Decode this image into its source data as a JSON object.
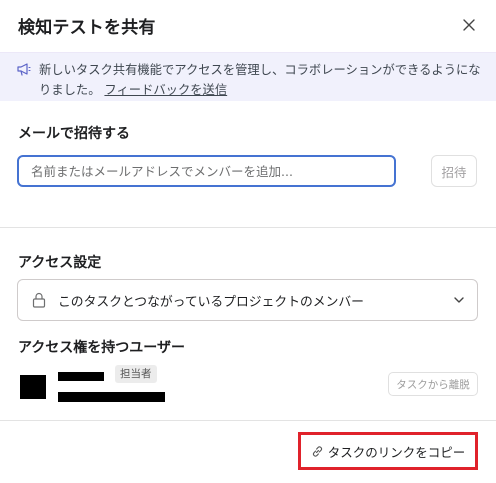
{
  "dialog": {
    "title": "検知テストを共有",
    "close_icon": "close-icon"
  },
  "banner": {
    "icon": "megaphone-icon",
    "text": "新しいタスク共有機能でアクセスを管理し、コラボレーションができるようになりました。",
    "link_label": "フィードバックを送信"
  },
  "invite": {
    "label": "メールで招待する",
    "placeholder": "名前またはメールアドレスでメンバーを追加...",
    "value": "",
    "button_label": "招待"
  },
  "access": {
    "label": "アクセス設定",
    "selected_value": "このタスクとつながっているプロジェクトのメンバー",
    "lock_icon": "lock-icon",
    "dropdown_icon": "chevron-down-icon"
  },
  "users": {
    "label": "アクセス権を持つユーザー",
    "items": [
      {
        "badge": "担当者",
        "remove_label": "タスクから離脱"
      }
    ]
  },
  "footer": {
    "copy_link_label": "タスクのリンクをコピー",
    "link_icon": "link-icon"
  },
  "colors": {
    "focus_border": "#4573d2",
    "banner_background": "#f1f1fc",
    "highlight_border": "#e0222b"
  }
}
